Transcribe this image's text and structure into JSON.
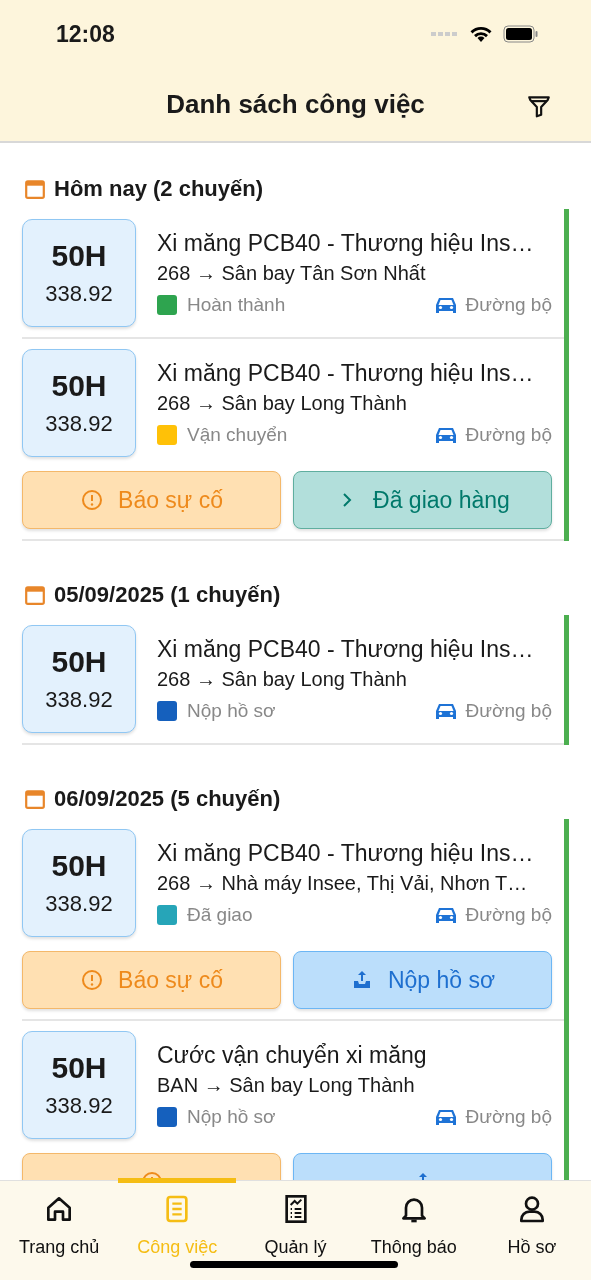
{
  "status_bar": {
    "time": "12:08"
  },
  "header": {
    "title": "Danh sách công việc"
  },
  "groups": [
    {
      "title": "Hôm nay (2 chuyến)",
      "trips": [
        {
          "plate": "50H",
          "plate_number": "338.92",
          "cargo": "Xi măng PCB40 - Thương hiệu Ins…",
          "route": "268 → Sân bay Tân Sơn Nhất",
          "status": "Hoàn thành",
          "color": "#2ea44f",
          "mode": "Đường bộ"
        },
        {
          "plate": "50H",
          "plate_number": "338.92",
          "cargo": "Xi măng PCB40 - Thương hiệu Ins…",
          "route": "268 → Sân bay Long Thành",
          "status": "Vận chuyển",
          "color": "#ffc107",
          "mode": "Đường bộ",
          "actions": [
            {
              "kind": "report",
              "label": "Báo sự cố"
            },
            {
              "kind": "delivered",
              "label": "Đã giao hàng"
            }
          ]
        }
      ]
    },
    {
      "title": "05/09/2025 (1 chuyến)",
      "trips": [
        {
          "plate": "50H",
          "plate_number": "338.92",
          "cargo": "Xi măng PCB40 - Thương hiệu Ins…",
          "route": "268 → Sân bay Long Thành",
          "status": "Nộp hồ sơ",
          "color": "#1560bd",
          "mode": "Đường bộ"
        }
      ]
    },
    {
      "title": "06/09/2025 (5 chuyến)",
      "trips": [
        {
          "plate": "50H",
          "plate_number": "338.92",
          "cargo": "Xi măng PCB40 - Thương hiệu Ins…",
          "route": "268 → Nhà máy Insee, Thị Vải, Nhơn T…",
          "status": "Đã giao",
          "color": "#26a5b8",
          "mode": "Đường bộ",
          "actions": [
            {
              "kind": "report",
              "label": "Báo sự cố"
            },
            {
              "kind": "submit",
              "label": "Nộp hồ sơ"
            }
          ]
        },
        {
          "plate": "50H",
          "plate_number": "338.92",
          "cargo": "Cước vận chuyển xi măng",
          "route": "BAN → Sân bay Long Thành",
          "status": "Nộp hồ sơ",
          "color": "#1560bd",
          "mode": "Đường bộ",
          "actions": [
            {
              "kind": "report"
            },
            {
              "kind": "submit"
            }
          ]
        }
      ]
    }
  ],
  "tabs": [
    {
      "label": "Trang chủ",
      "selected": false
    },
    {
      "label": "Công việc",
      "selected": true
    },
    {
      "label": "Quản lý",
      "selected": false
    },
    {
      "label": "Thông báo",
      "selected": false
    },
    {
      "label": "Hồ sơ",
      "selected": false
    }
  ]
}
